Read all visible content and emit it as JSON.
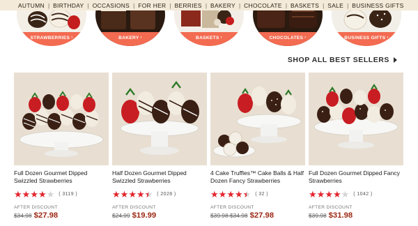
{
  "nav": {
    "items": [
      "AUTUMN",
      "BIRTHDAY",
      "OCCASIONS",
      "FOR HER",
      "BERRIES",
      "BAKERY",
      "CHOCOLATE",
      "BASKETS",
      "SALE",
      "BUSINESS GIFTS"
    ]
  },
  "categories": [
    {
      "label": "STRAWBERRIES",
      "chevron": "›"
    },
    {
      "label": "BAKERY",
      "chevron": "›"
    },
    {
      "label": "BASKETS",
      "chevron": "›"
    },
    {
      "label": "CHOCOLATES",
      "chevron": "›"
    },
    {
      "label": "BUSINESS GIFTS",
      "chevron": "›"
    }
  ],
  "shop_all": {
    "label": "SHOP ALL BEST SELLERS"
  },
  "products": [
    {
      "title": "Full Dozen Gourmet Dipped Swizzled Strawberries",
      "stars": [
        1,
        1,
        1,
        1,
        0
      ],
      "rating_count": "3119",
      "after_label": "AFTER DISCOUNT",
      "old_price": "$34.98",
      "new_price": "$27.98"
    },
    {
      "title": "Half Dozen Gourmet Dipped Swizzled Strawberries",
      "stars": [
        1,
        1,
        1,
        1,
        0.5
      ],
      "rating_count": "2028",
      "after_label": "AFTER DISCOUNT",
      "old_price": "$24.99",
      "new_price": "$19.99"
    },
    {
      "title": "4 Cake Truffles™ Cake Balls & Half Dozen Fancy Strawberries",
      "stars": [
        1,
        1,
        1,
        1,
        0.5
      ],
      "rating_count": "32",
      "after_label": "AFTER DISCOUNT",
      "old_price": "$39.98 $34.98",
      "new_price": "$27.98"
    },
    {
      "title": "Full Dozen Gourmet Dipped Fancy Strawberries",
      "stars": [
        1,
        1,
        1,
        1,
        0
      ],
      "rating_count": "1042",
      "after_label": "AFTER DISCOUNT",
      "old_price": "$39.98",
      "new_price": "$31.98"
    }
  ],
  "colors": {
    "accent": "#f36b51",
    "price": "#9c2a15",
    "star": "#e2242c",
    "nav_bg": "#f3ead9"
  }
}
